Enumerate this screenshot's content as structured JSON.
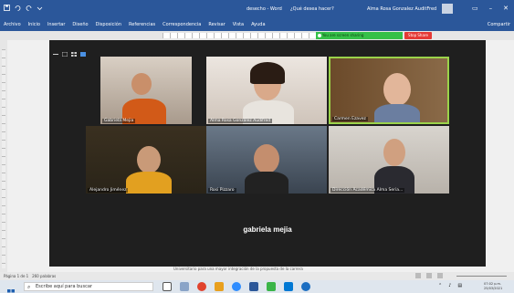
{
  "titlebar": {
    "doc_title": "desecho - Word",
    "search_prompt": "¿Qué desea hacer?",
    "user_name": "Alma Rosa Gonzalez AuditFred"
  },
  "ribbon": {
    "tabs": [
      "Archivo",
      "Inicio",
      "Insertar",
      "Diseño",
      "Disposición",
      "Referencias",
      "Correspondencia",
      "Revisar",
      "Vista",
      "Ayuda"
    ],
    "share_label": "Compartir"
  },
  "zoom": {
    "share_status": "You are screen sharing",
    "stop_label": "Stop Share",
    "participants": [
      "Gabriela Mejia",
      "Alma Rosa González Audifred",
      "Carmen Ezavez",
      "Alejandro Jiménez",
      "Rosi Pizzaro",
      "Dirección Académica Alma Seria..."
    ],
    "active_speaker": "gabriela mejia"
  },
  "document": {
    "visible_text": "Universitario para una mayor integración de la propuesta de la carrera"
  },
  "statusbar": {
    "page_info": "Página 1 de 1",
    "word_count": "260 palabras"
  },
  "taskbar": {
    "search_placeholder": "Escribe aquí para buscar",
    "time": "07:02 p.m.",
    "date": "25/03/2021"
  },
  "colors": {
    "word_blue": "#2b579a",
    "share_green": "#35c048",
    "stop_red": "#e53935",
    "zoom_bg": "#1f1f1f"
  }
}
